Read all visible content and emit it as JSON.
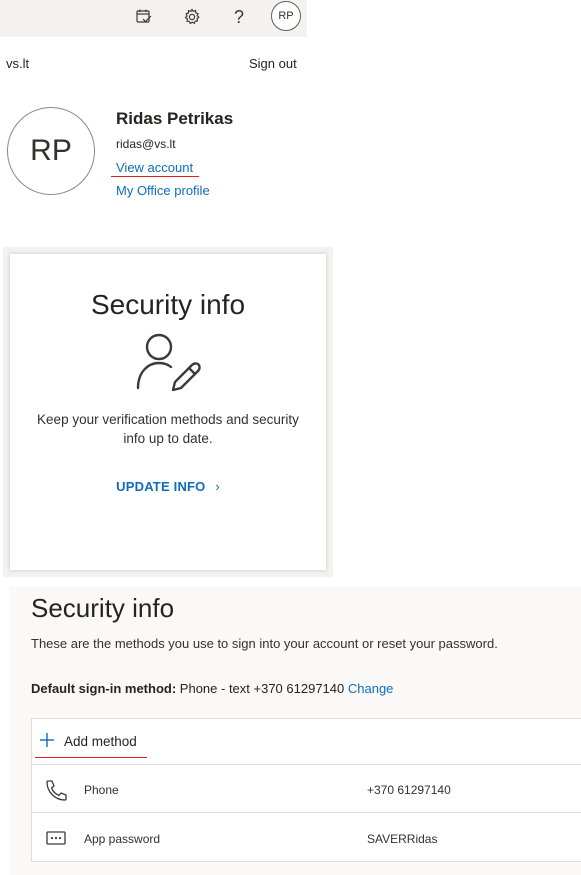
{
  "header": {
    "avatar_initials": "RP",
    "icons": [
      "calendar-check-icon",
      "gear-icon",
      "help-icon"
    ]
  },
  "account": {
    "org": "vs.lt",
    "sign_out": "Sign out",
    "initials": "RP",
    "name": "Ridas Petrikas",
    "email": "ridas@vs.lt",
    "view_account": "View account",
    "office_profile": "My Office profile"
  },
  "card": {
    "title": "Security info",
    "icon": "user-edit-icon",
    "description": "Keep your verification methods and security info up to date.",
    "action": "UPDATE INFO",
    "action_chevron": "›"
  },
  "page": {
    "title": "Security info",
    "subtitle": "These are the methods you use to sign into your account or reset your password.",
    "default_label": "Default sign-in method:",
    "default_value": "Phone - text +370 61297140",
    "change": "Change",
    "add_method": "Add method",
    "methods": [
      {
        "icon": "phone-icon",
        "type": "Phone",
        "detail": "+370 61297140"
      },
      {
        "icon": "app-password-icon",
        "type": "App password",
        "detail": "SAVERRidas"
      }
    ]
  },
  "colors": {
    "accent": "#0f6cbd",
    "highlight_underline": "#e0201b",
    "header_bg": "#f3f2f1"
  }
}
